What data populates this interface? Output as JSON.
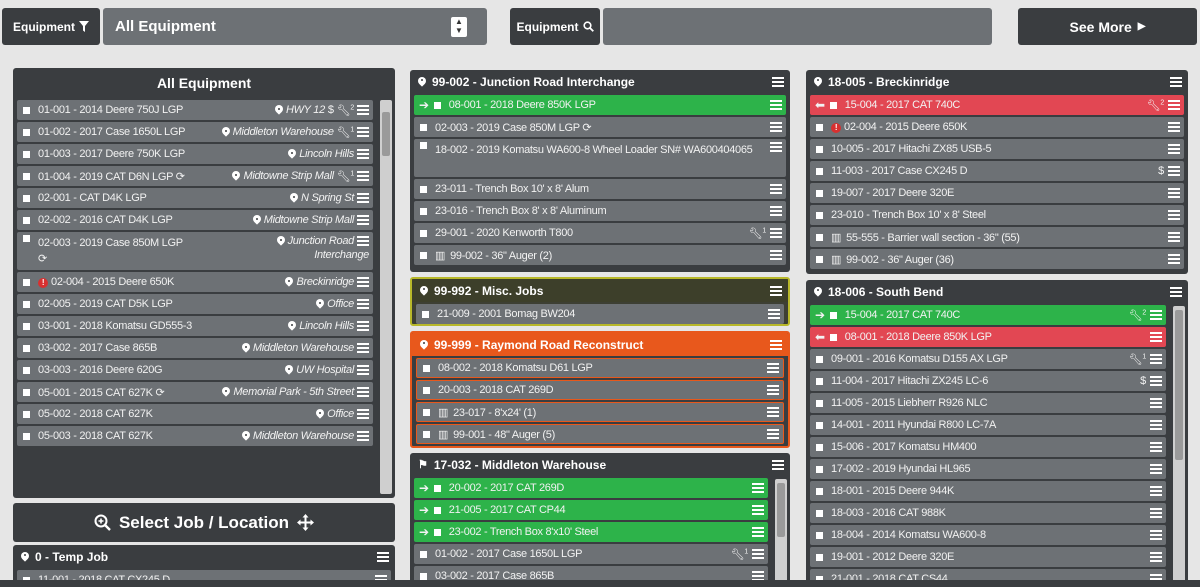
{
  "topbar": {
    "filter_label": "Equipment",
    "filter_value": "All Equipment",
    "search_label": "Equipment",
    "search_placeholder": "",
    "see_more": "See More"
  },
  "left": {
    "title": "All Equipment",
    "rows": [
      {
        "text": "01-001 - 2014 Deere 750J LGP",
        "location": "HWY 12",
        "dollar": true,
        "wrench": "2"
      },
      {
        "text": "01-002 - 2017 Case 1650L LGP",
        "location": "Middleton Warehouse",
        "wrench": "1"
      },
      {
        "text": "01-003 - 2017 Deere 750K LGP",
        "location": "Lincoln Hills"
      },
      {
        "text": "01-004 - 2019 CAT D6N LGP",
        "sync": true,
        "location": "Midtowne Strip Mall",
        "wrench": "1"
      },
      {
        "text": "02-001 - CAT D4K LGP",
        "location": "N Spring St"
      },
      {
        "text": "02-002 - 2016 CAT D4K LGP",
        "location": "Midtowne Strip Mall"
      },
      {
        "text": "02-003 - 2019 Case 850M LGP",
        "location": "Junction Road",
        "location2": "Interchange",
        "sync2": true,
        "tall": true
      },
      {
        "text": "02-004 - 2015 Deere 650K",
        "alert": true,
        "location": "Breckinridge"
      },
      {
        "text": "02-005 - 2019 CAT D5K LGP",
        "location": "Office"
      },
      {
        "text": "03-001 - 2018 Komatsu GD555-3",
        "location": "Lincoln Hills"
      },
      {
        "text": "03-002 - 2017 Case 865B",
        "location": "Middleton Warehouse"
      },
      {
        "text": "03-003 - 2016 Deere 620G",
        "location": "UW Hospital"
      },
      {
        "text": "05-001 - 2015 CAT 627K",
        "sync": true,
        "location": "Memorial Park - 5th Street"
      },
      {
        "text": "05-002 - 2018 CAT 627K",
        "location": "Office"
      },
      {
        "text": "05-003 - 2018 CAT 627K",
        "location": "Middleton Warehouse"
      }
    ]
  },
  "select_job": "Select Job / Location",
  "temp_job": {
    "title": "0 - Temp Job",
    "rows": [
      {
        "text": "11-001 - 2018 CAT CX245 D"
      }
    ]
  },
  "junction": {
    "title": "99-002 - Junction Road Interchange",
    "rows": [
      {
        "text": "08-001 - 2018 Deere 850K LGP",
        "status": "in"
      },
      {
        "text": "02-003 - 2019 Case 850M LGP",
        "sync": true
      },
      {
        "text": "18-002 - 2019 Komatsu WA600-8 Wheel Loader SN# WA600404065",
        "tall": true
      },
      {
        "text": "23-011 - Trench Box 10' x 8' Alum"
      },
      {
        "text": "23-016 - Trench Box 8' x 8' Aluminum"
      },
      {
        "text": "29-001 - 2020 Kenworth T800",
        "wrench": "1"
      },
      {
        "text": "99-002 - 36\" Auger (2)",
        "pallet": true
      }
    ]
  },
  "misc": {
    "title": "99-992 - Misc. Jobs",
    "rows": [
      {
        "text": "21-009 - 2001 Bomag BW204"
      }
    ]
  },
  "raymond": {
    "title": "99-999 - Raymond Road Reconstruct",
    "rows": [
      {
        "text": "08-002 - 2018 Komatsu D61 LGP"
      },
      {
        "text": "20-003 - 2018 CAT 269D"
      },
      {
        "text": "23-017 - 8'x24' (1)",
        "pallet": true
      },
      {
        "text": "99-001 - 48\" Auger (5)",
        "pallet": true
      }
    ]
  },
  "middleton": {
    "title": "17-032 - Middleton Warehouse",
    "rows": [
      {
        "text": "20-002 - 2017 CAT 269D",
        "status": "in"
      },
      {
        "text": "21-005 - 2017 CAT CP44",
        "status": "in"
      },
      {
        "text": "23-002 - Trench Box 8'x10' Steel",
        "status": "in"
      },
      {
        "text": "01-002 - 2017 Case 1650L LGP",
        "wrench": "1"
      },
      {
        "text": "03-002 - 2017 Case 865B"
      }
    ]
  },
  "breckinridge": {
    "title": "18-005 - Breckinridge",
    "rows": [
      {
        "text": "15-004 - 2017 CAT 740C",
        "status": "out",
        "wrench": "2"
      },
      {
        "text": "02-004 - 2015 Deere 650K",
        "alert": true
      },
      {
        "text": "10-005 - 2017 Hitachi ZX85 USB-5"
      },
      {
        "text": "11-003 - 2017 Case CX245 D",
        "dollar": true
      },
      {
        "text": "19-007 - 2017 Deere 320E"
      },
      {
        "text": "23-010 - Trench Box 10' x 8' Steel"
      },
      {
        "text": "55-555 - Barrier wall section - 36\" (55)",
        "pallet": true
      },
      {
        "text": "99-002 - 36\" Auger (36)",
        "pallet": true
      }
    ]
  },
  "southbend": {
    "title": "18-006 - South Bend",
    "rows": [
      {
        "text": "15-004 - 2017 CAT 740C",
        "status": "in",
        "wrench": "2"
      },
      {
        "text": "08-001 - 2018 Deere 850K LGP",
        "status": "out"
      },
      {
        "text": "09-001 - 2016 Komatsu D155 AX LGP",
        "wrench": "1"
      },
      {
        "text": "11-004 - 2017 Hitachi ZX245 LC-6",
        "dollar": true
      },
      {
        "text": "11-005 - 2015 Liebherr R926 NLC"
      },
      {
        "text": "14-001 - 2011 Hyundai R800 LC-7A"
      },
      {
        "text": "15-006 - 2017 Komatsu HM400"
      },
      {
        "text": "17-002 - 2019 Hyundai HL965"
      },
      {
        "text": "18-001 - 2015 Deere 944K"
      },
      {
        "text": "18-003 - 2016 CAT 988K"
      },
      {
        "text": "18-004 - 2014 Komatsu WA600-8"
      },
      {
        "text": "19-001 - 2012 Deere 320E"
      },
      {
        "text": "21-001 - 2018 CAT CS44"
      }
    ]
  },
  "icons": {
    "filter": "filter-icon",
    "search": "search-icon",
    "chevron": "chevron-right-icon",
    "pin": "map-pin-icon",
    "flag": "flag-icon",
    "menu": "menu-icon",
    "wrench": "wrench-icon",
    "dollar": "dollar-icon",
    "sync": "sync-icon",
    "alert": "alert-icon",
    "pallet": "pallet-icon",
    "arrow-in": "arrow-in-icon",
    "arrow-out": "arrow-out-icon"
  },
  "colors": {
    "panel": "#3a3d40",
    "row": "#6d7175",
    "in": "#2db34a",
    "out": "#e24753",
    "orange": "#e8581c",
    "yellow": "#b8b82a"
  }
}
